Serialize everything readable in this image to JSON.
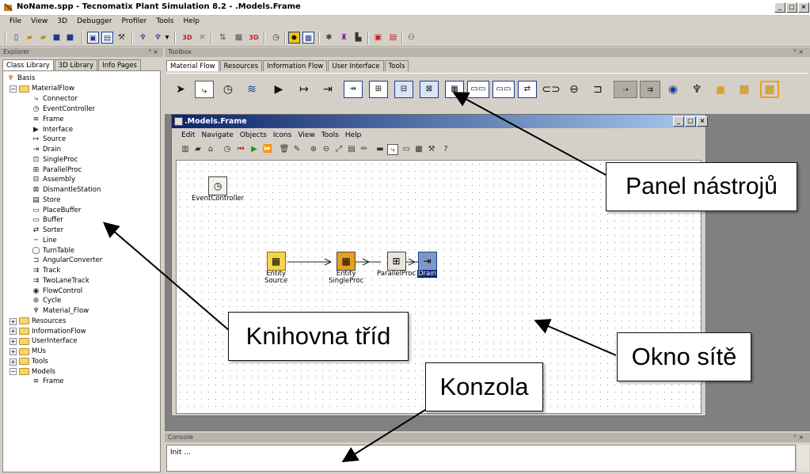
{
  "window": {
    "title": "NoName.spp - Tecnomatix Plant Simulation 8.2 - .Models.Frame",
    "minimize": "_",
    "maximize": "□",
    "close": "×"
  },
  "menu": [
    "File",
    "View",
    "3D",
    "Debugger",
    "Profiler",
    "Tools",
    "Help"
  ],
  "toolbar_icons": [
    "new-file",
    "open-file",
    "open-folder",
    "save",
    "save-all",
    "window-layout",
    "toolbox-toggle",
    "tools",
    "hierarchy",
    "hierarchy-dropdown",
    "3d-view",
    "3d-close",
    "sort",
    "stack",
    "3d-box",
    "clock",
    "event-controller",
    "watch-grid",
    "debug",
    "workers",
    "mixed",
    "image",
    "chart",
    "binoculars"
  ],
  "explorer": {
    "title": "Explorer",
    "pin": "ᴾ ×",
    "tabs": [
      "Class Library",
      "3D Library",
      "Info Pages"
    ],
    "root": "Basis",
    "material_flow": {
      "label": "MaterialFlow",
      "items": [
        "Connector",
        "EventController",
        "Frame",
        "Interface",
        "Source",
        "Drain",
        "SingleProc",
        "ParallelProc",
        "Assembly",
        "DismantleStation",
        "Store",
        "PlaceBuffer",
        "Buffer",
        "Sorter",
        "Line",
        "TurnTable",
        "AngularConverter",
        "Track",
        "TwoLaneTrack",
        "FlowControl",
        "Cycle",
        "Material_Flow"
      ]
    },
    "folders": [
      "Resources",
      "InformationFlow",
      "UserInterface",
      "MUs",
      "Tools",
      "Models"
    ],
    "models_child": "Frame"
  },
  "toolbox": {
    "title": "Toolbox",
    "pin": "ᴾ ×",
    "tabs": [
      "Material Flow",
      "Resources",
      "Information Flow",
      "User Interface",
      "Tools"
    ]
  },
  "network_window": {
    "title": ".Models.Frame",
    "menu": [
      "Edit",
      "Navigate",
      "Objects",
      "Icons",
      "View",
      "Tools",
      "Help"
    ],
    "objects": {
      "event_controller": "EventController",
      "source": [
        "Entity",
        "Source"
      ],
      "singleproc": [
        "Entity",
        "SingleProc"
      ],
      "parallelproc": "ParallelProc",
      "drain": "Drain"
    }
  },
  "console": {
    "title": "Console",
    "pin": "ᴾ ×",
    "text": "Init ..."
  },
  "callouts": {
    "toolbox": "Panel nástrojů",
    "library": "Knihovna tříd",
    "network": "Okno sítě",
    "console": "Konzola"
  }
}
